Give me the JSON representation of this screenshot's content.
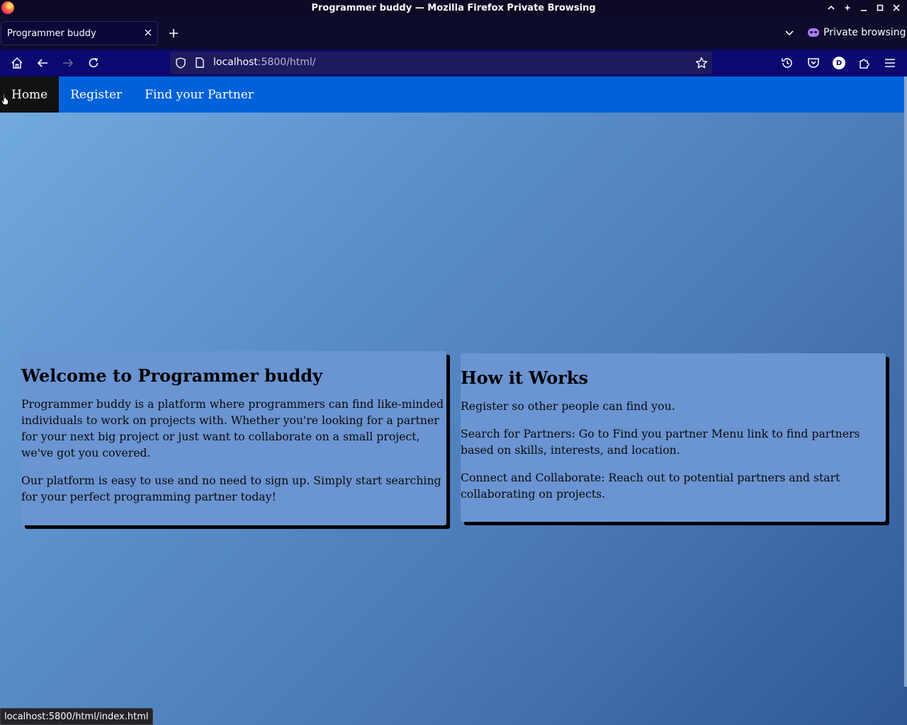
{
  "window": {
    "title": "Programmer buddy — Mozilla Firefox Private Browsing"
  },
  "tabs": [
    {
      "title": "Programmer buddy",
      "active": true
    }
  ],
  "private_label": "Private browsing",
  "urlbar": {
    "host": "localhost",
    "rest": ":5800/html/"
  },
  "site_nav": {
    "items": [
      {
        "label": "Home",
        "active": true
      },
      {
        "label": "Register",
        "active": false
      },
      {
        "label": "Find your Partner",
        "active": false
      }
    ]
  },
  "welcome": {
    "heading": "Welcome to Programmer buddy",
    "paragraphs": [
      "Programmer buddy is a platform where programmers can find like-minded individuals to work on projects with. Whether you're looking for a partner for your next big project or just want to collaborate on a small project, we've got you covered.",
      "Our platform is easy to use and no need to sign up. Simply start searching for your perfect programming partner today!"
    ]
  },
  "how_it_works": {
    "heading": "How it Works",
    "paragraphs": [
      "Register so other people can find you.",
      "Search for Partners: Go to Find you partner Menu link to find partners based on skills, interests, and location.",
      "Connect and Collaborate: Reach out to potential partners and start collaborating on projects."
    ]
  },
  "status_bar": {
    "link": "localhost:5800/html/index.html"
  },
  "account_initial": "D",
  "colors": {
    "site_nav_bg": "#0061d9",
    "active_nav_bg": "#111111",
    "card_bg": "#6b94d2",
    "browser_chrome": "#0b0870"
  }
}
